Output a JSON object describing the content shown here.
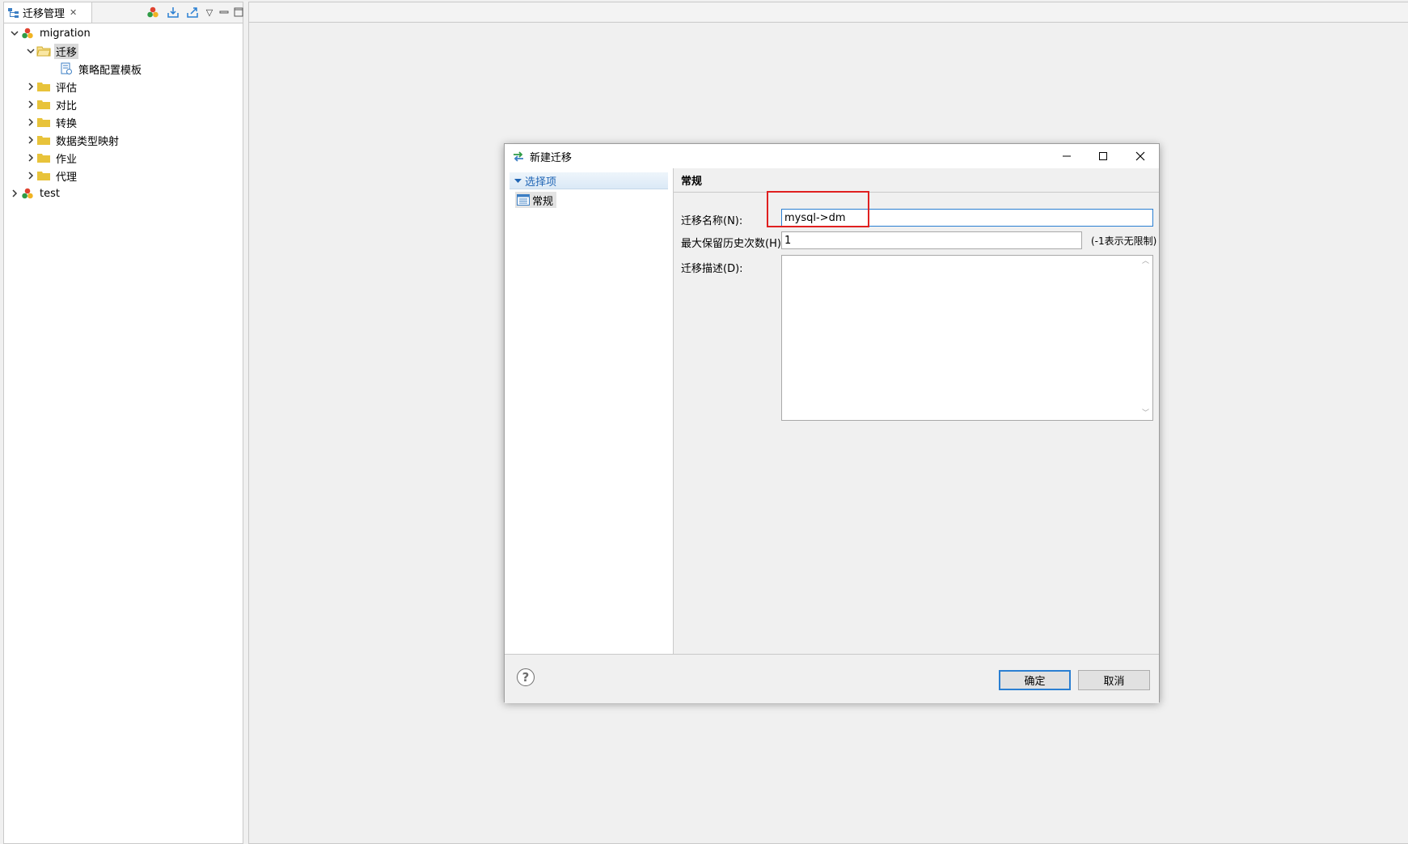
{
  "view": {
    "tab_title": "迁移管理",
    "tools": [
      "add-connection-icon",
      "import-icon",
      "export-icon",
      "view-menu-icon",
      "minimize-icon",
      "maximize-icon"
    ]
  },
  "tree": {
    "nodes": [
      {
        "label": "migration",
        "expanded": true,
        "icon": "db-connection-icon"
      },
      {
        "label": "迁移",
        "expanded": true,
        "selected": true,
        "icon": "folder-open-icon"
      },
      {
        "label": "策略配置模板",
        "icon": "template-icon"
      },
      {
        "label": "评估",
        "expanded": false,
        "icon": "folder-icon"
      },
      {
        "label": "对比",
        "expanded": false,
        "icon": "folder-icon"
      },
      {
        "label": "转换",
        "expanded": false,
        "icon": "folder-icon"
      },
      {
        "label": "数据类型映射",
        "expanded": false,
        "icon": "folder-icon"
      },
      {
        "label": "作业",
        "expanded": false,
        "icon": "folder-icon"
      },
      {
        "label": "代理",
        "expanded": false,
        "icon": "folder-icon"
      },
      {
        "label": "test",
        "expanded": false,
        "icon": "db-connection-icon"
      }
    ]
  },
  "dialog": {
    "title": "新建迁移",
    "options_header": "选择项",
    "options_item": "常规",
    "section_title": "常规",
    "fields": {
      "name_label": "迁移名称(N):",
      "name_value": "mysql->dm",
      "history_label": "最大保留历史次数(H):",
      "history_value": "1",
      "history_hint": "(-1表示无限制)",
      "desc_label": "迁移描述(D):",
      "desc_value": ""
    },
    "buttons": {
      "ok": "确定",
      "cancel": "取消"
    },
    "help_glyph": "?"
  },
  "colors": {
    "accent": "#2a7fd2",
    "highlight": "#e02020",
    "folder": "#e8c33a"
  }
}
